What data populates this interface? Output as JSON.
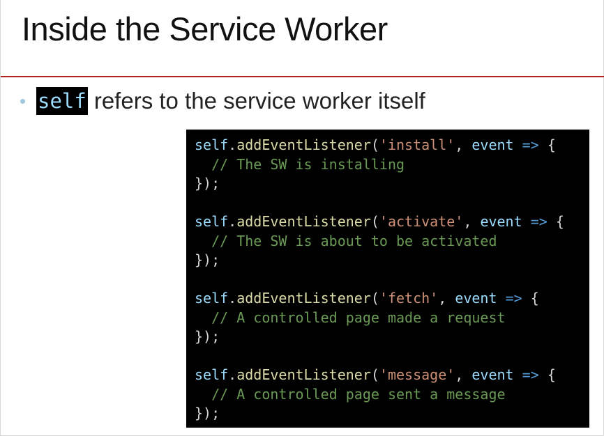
{
  "slide": {
    "title": "Inside the Service Worker",
    "bullet": {
      "marker": "•",
      "code_keyword": "self",
      "text": "refers to the service worker itself"
    },
    "code_listeners": [
      {
        "obj": "self",
        "dot": ".",
        "method": "addEventListener",
        "open": "(",
        "event_string": "'install'",
        "comma": ",",
        "param": "event",
        "arrow": "=>",
        "brace_open": "{",
        "comment": "// The SW is installing",
        "close": "});"
      },
      {
        "obj": "self",
        "dot": ".",
        "method": "addEventListener",
        "open": "(",
        "event_string": "'activate'",
        "comma": ",",
        "param": "event",
        "arrow": "=>",
        "brace_open": "{",
        "comment": "// The SW is about to be activated",
        "close": "});"
      },
      {
        "obj": "self",
        "dot": ".",
        "method": "addEventListener",
        "open": "(",
        "event_string": "'fetch'",
        "comma": ",",
        "param": "event",
        "arrow": "=>",
        "brace_open": "{",
        "comment": "// A controlled page made a request",
        "close": "});"
      },
      {
        "obj": "self",
        "dot": ".",
        "method": "addEventListener",
        "open": "(",
        "event_string": "'message'",
        "comma": ",",
        "param": "event",
        "arrow": "=>",
        "brace_open": "{",
        "comment": "// A controlled page sent a message",
        "close": "});"
      }
    ]
  },
  "colors": {
    "title_rule": "#b22222",
    "bullet_marker": "#9fc6dd",
    "code_background": "#000000",
    "code_identifier": "#9cdcfe",
    "code_function": "#dcdcaa",
    "code_string": "#ce9178",
    "code_keyword_arrow": "#569cd6",
    "code_comment": "#6a9955",
    "code_punctuation": "#d4d4d4"
  }
}
